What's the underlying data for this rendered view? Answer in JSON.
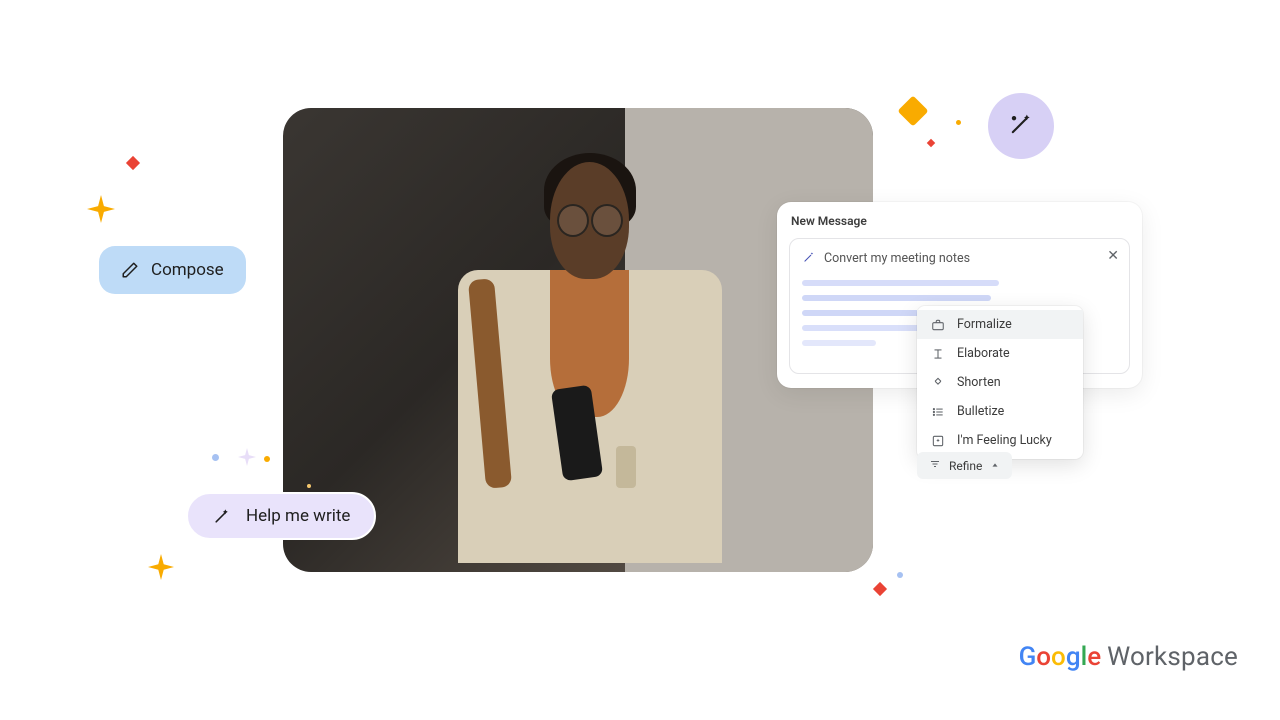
{
  "compose": {
    "label": "Compose"
  },
  "help": {
    "label": "Help me write"
  },
  "window": {
    "title": "New Message",
    "prompt": "Convert my meeting notes"
  },
  "refine_menu": {
    "items": [
      {
        "label": "Formalize"
      },
      {
        "label": "Elaborate"
      },
      {
        "label": "Shorten"
      },
      {
        "label": "Bulletize"
      },
      {
        "label": "I'm Feeling Lucky"
      }
    ]
  },
  "refine_btn": {
    "label": "Refine"
  },
  "logo": {
    "g": "G",
    "o1": "o",
    "o2": "o",
    "g2": "g",
    "l": "l",
    "e": "e",
    "workspace": "Workspace"
  }
}
